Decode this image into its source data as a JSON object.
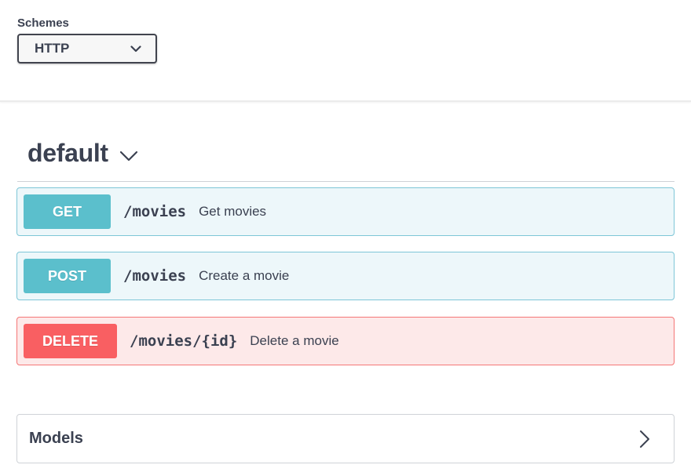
{
  "schemes": {
    "label": "Schemes",
    "selected": "HTTP",
    "icon": "chevron-down-icon"
  },
  "tag": {
    "title": "default",
    "icon": "chevron-down-icon"
  },
  "operations": [
    {
      "method": "GET",
      "path": "/movies",
      "summary": "Get movies",
      "color": "#61affe"
    },
    {
      "method": "POST",
      "path": "/movies",
      "summary": "Create a movie",
      "color": "#5bbfcc"
    },
    {
      "method": "DELETE",
      "path": "/movies/{id}",
      "summary": "Delete a movie",
      "color": "#f93e3e"
    }
  ],
  "models": {
    "label": "Models",
    "icon": "chevron-right-icon"
  }
}
